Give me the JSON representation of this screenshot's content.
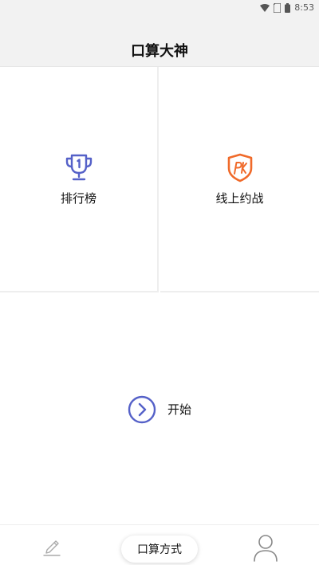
{
  "status_bar": {
    "time": "8:53"
  },
  "header": {
    "title": "口算大神"
  },
  "tiles": {
    "leaderboard": {
      "label": "排行榜",
      "icon": "trophy-icon",
      "color": "#5561c8"
    },
    "battle": {
      "label": "线上约战",
      "icon": "pk-shield-icon",
      "color": "#f06a2a"
    }
  },
  "start": {
    "label": "开始",
    "icon": "chevron-right-circle-icon",
    "color": "#5561c8"
  },
  "bottom_nav": {
    "center_label": "口算方式",
    "left_icon": "pencil-icon",
    "right_icon": "profile-icon"
  }
}
